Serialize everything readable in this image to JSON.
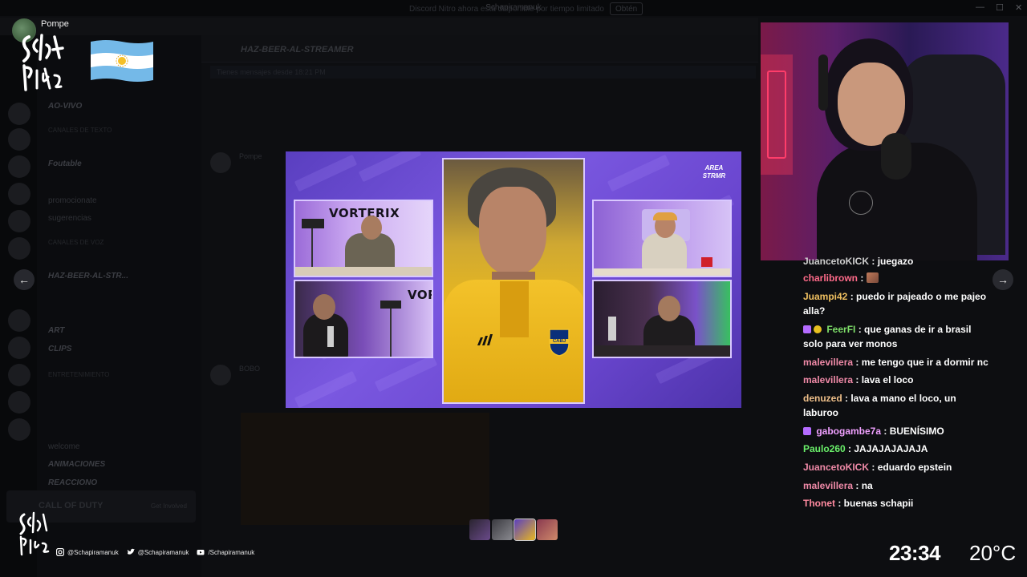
{
  "window": {
    "title": "Schapiramanuk"
  },
  "background": {
    "banner_text": "Discord Nitro ahora está disponible por tiempo limitado",
    "banner_button": "Obtén",
    "channel_name": "HAZ-BEER-AL-STREAMER",
    "pinned": "Tienes mensajes desde 18:21 PM",
    "channels": {
      "ao_vivo": "AO-VIVO",
      "category_1": "Canales de texto",
      "foutable": "Foutable",
      "promocionate": "promocionate",
      "sugerencias": "sugerencias",
      "category_2": "Canales de voz",
      "haz_beer": "HAZ-BEER-AL-STR...",
      "art": "ART",
      "clips": "CLIPS",
      "category_3": "Entretenimiento",
      "welcome": "welcome",
      "animaciones": "ANIMACIONES",
      "reacciono": "REACCIONO"
    },
    "game_title": "CALL OF DUTY",
    "game_button": "Get Involved",
    "msg_author_1": "Pompe",
    "msg_author_2": "BOBO"
  },
  "overlay": {
    "streamer_name": "Pompe",
    "logo_text": "Scha Pira",
    "flag": "argentina-flag"
  },
  "stream": {
    "left_top_label": "VORTERIX",
    "left_bottom_label": "VOR",
    "badge_line1": "AREA",
    "badge_line2": "STRMR",
    "crest_text": "CABJ"
  },
  "chat": [
    {
      "user": "JuancetoKICK",
      "color": "#cfcfcf",
      "text": ": juegazo",
      "badges": []
    },
    {
      "user": "charlibrown",
      "color": "#ff6b8a",
      "text": ":",
      "badges": [],
      "emote": true
    },
    {
      "user": "Juampi42",
      "color": "#f0c060",
      "text": ": puedo ir pajeado o me pajeo alla?",
      "badges": []
    },
    {
      "user": "FeerFI",
      "color": "#7fe06a",
      "text": ": que ganas de ir a brasil solo para ver monos",
      "badges": [
        "sub",
        "gold"
      ]
    },
    {
      "user": "malevillera",
      "color": "#f08aa8",
      "text": ": me tengo que ir a dormir nc",
      "badges": []
    },
    {
      "user": "malevillera",
      "color": "#f08aa8",
      "text": ": lava el loco",
      "badges": []
    },
    {
      "user": "denuzed",
      "color": "#f0c08a",
      "text": ": lava a mano el loco, un laburoo",
      "badges": []
    },
    {
      "user": "gabogambe7a",
      "color": "#f0a0ff",
      "text": ": BUENÍSIMO",
      "badges": [
        "sub"
      ]
    },
    {
      "user": "Paulo260",
      "color": "#6af06a",
      "text": ": JAJAJAJAJAJA",
      "badges": []
    },
    {
      "user": "JuancetoKICK",
      "color": "#f08aa8",
      "text": ": eduardo epstein",
      "badges": []
    },
    {
      "user": "malevillera",
      "color": "#f08aa8",
      "text": ": na",
      "badges": []
    },
    {
      "user": "Thonet",
      "color": "#ff8aa0",
      "text": ": buenas schapii",
      "badges": []
    }
  ],
  "socials": {
    "instagram": "@Schapiramanuk",
    "twitter": "@Schapiramanuk",
    "youtube": "/Schapiramanuk"
  },
  "status": {
    "time": "23:34",
    "temperature": "20°C"
  },
  "colors": {
    "stream_purple": "#6a46cf",
    "jersey_yellow": "#e8b820",
    "accent_pink": "#ff3d9a"
  }
}
